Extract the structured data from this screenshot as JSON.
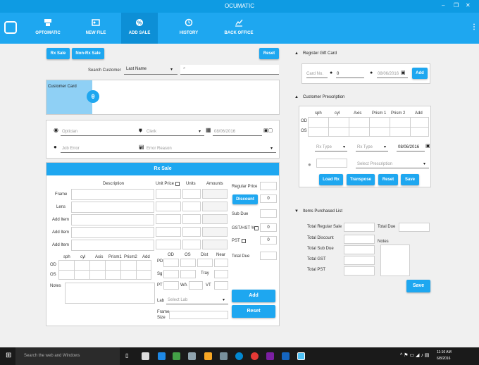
{
  "app": {
    "title": "OCUMATIC"
  },
  "nav": {
    "items": [
      {
        "label": "OPTOMATIC",
        "icon": "optomatic-icon"
      },
      {
        "label": "NEW FILE",
        "icon": "new-file-icon"
      },
      {
        "label": "ADD SALE",
        "icon": "add-sale-icon"
      },
      {
        "label": "HISTORY",
        "icon": "history-icon"
      },
      {
        "label": "BACK OFFICE",
        "icon": "back-office-icon"
      }
    ]
  },
  "sale": {
    "rx_sale": "Rx Sale",
    "non_rx_sale": "Non-Rx Sale",
    "reset": "Reset",
    "search_customer": "Search Customer",
    "search_by": "Last Name",
    "customer_card": "Customer Card",
    "optician": "Optician",
    "clerk": "Clerk",
    "date": "08/06/2016",
    "job_error": "Job Error",
    "error_reason": "Error Reason"
  },
  "rx": {
    "title": "Rx Sale",
    "description": "Description",
    "unit_price": "Unit Price",
    "units": "Units",
    "amounts": "Amounts",
    "rows": [
      "Frame",
      "Lens",
      "Add Item",
      "Add Item",
      "Add Item"
    ],
    "regular_price": "Regular Price",
    "discount": "Discount",
    "discount_value": "0",
    "sub_due": "Sub Due",
    "gst_hst": "GST/HST %",
    "gst_value": "0",
    "pst": "PST",
    "pst_value": "0",
    "total_due": "Total Due",
    "presc_headers": [
      "sph",
      "cyl",
      "Axis",
      "Prism1",
      "Prism2",
      "Add"
    ],
    "od": "OD",
    "os": "OS",
    "notes": "Notes",
    "measure_headers": [
      "OD",
      "OS",
      "Dist",
      "Near"
    ],
    "pd": "PD",
    "sg": "Sg",
    "tray": "Tray",
    "pt": "PT",
    "wa": "WA",
    "vt": "VT",
    "lab": "Lab",
    "select_lab": "Select Lab",
    "frame_size": "Frame\nSize",
    "add": "Add",
    "reset": "Reset"
  },
  "gift": {
    "title": "Register Gift Card",
    "card_no": "Card No.",
    "amount": "0",
    "date": "08/06/2016",
    "add": "Add"
  },
  "presc": {
    "title": "Customer Prescription",
    "headers": [
      "sph",
      "cyl",
      "Axis",
      "Prism 1",
      "Prism 2",
      "Add"
    ],
    "od": "OD",
    "os": "OS",
    "rx_type1": "Rx Type",
    "rx_type2": "Rx Type",
    "date": "08/06/2016",
    "select_presc": "Select Prescription",
    "load_rx": "Load Rx",
    "transpose": "Transpose",
    "reset": "Reset",
    "save": "Save"
  },
  "purchased": {
    "title": "Items Purchased List",
    "total_regular": "Total Regular Sale",
    "total_due": "Total Due",
    "total_discount": "Total Discount",
    "notes": "Notes",
    "total_sub_due": "Total Sub Due",
    "total_gst": "Total GST",
    "total_pst": "Total PST",
    "save": "Save"
  },
  "taskbar": {
    "search": "Search the web and Windows",
    "time": "11:16 AM",
    "date": "6/8/2016"
  }
}
